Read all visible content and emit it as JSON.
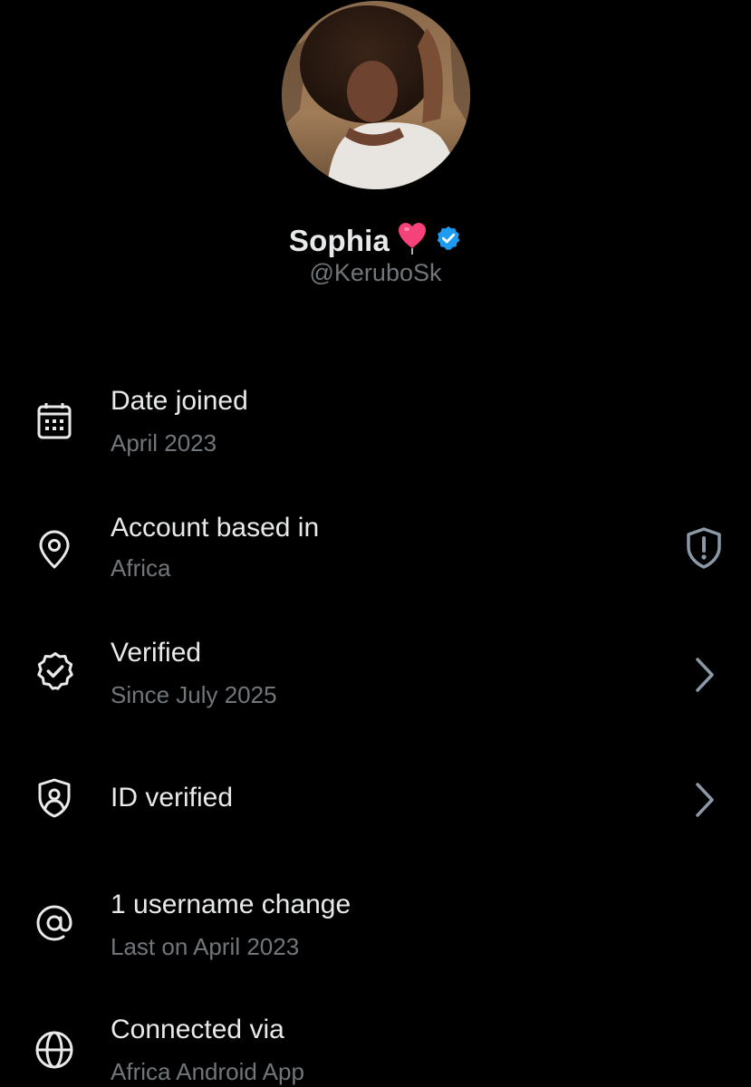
{
  "profile": {
    "display_name": "Sophia",
    "name_emoji": "heart-balloon-emoji",
    "verified_badge_color": "#1d9bf0",
    "handle": "@KeruboSk"
  },
  "about_items": [
    {
      "icon": "calendar-icon",
      "title": "Date joined",
      "subtitle": "April 2023"
    },
    {
      "icon": "location-pin-icon",
      "title": "Account based in",
      "subtitle": "Africa",
      "trailing_icon": "shield-alert-icon"
    },
    {
      "icon": "verified-badge-icon",
      "title": "Verified",
      "subtitle": "Since July 2025",
      "trailing_icon": "chevron-right-icon"
    },
    {
      "icon": "id-shield-icon",
      "title": "ID verified",
      "trailing_icon": "chevron-right-icon"
    },
    {
      "icon": "at-sign-icon",
      "title": "1 username change",
      "subtitle": "Last on April 2023"
    },
    {
      "icon": "globe-icon",
      "title": "Connected via",
      "subtitle": "Africa Android App"
    }
  ],
  "colors": {
    "background": "#000000",
    "primary_text": "#e7e9ea",
    "secondary_text": "#71767b"
  }
}
